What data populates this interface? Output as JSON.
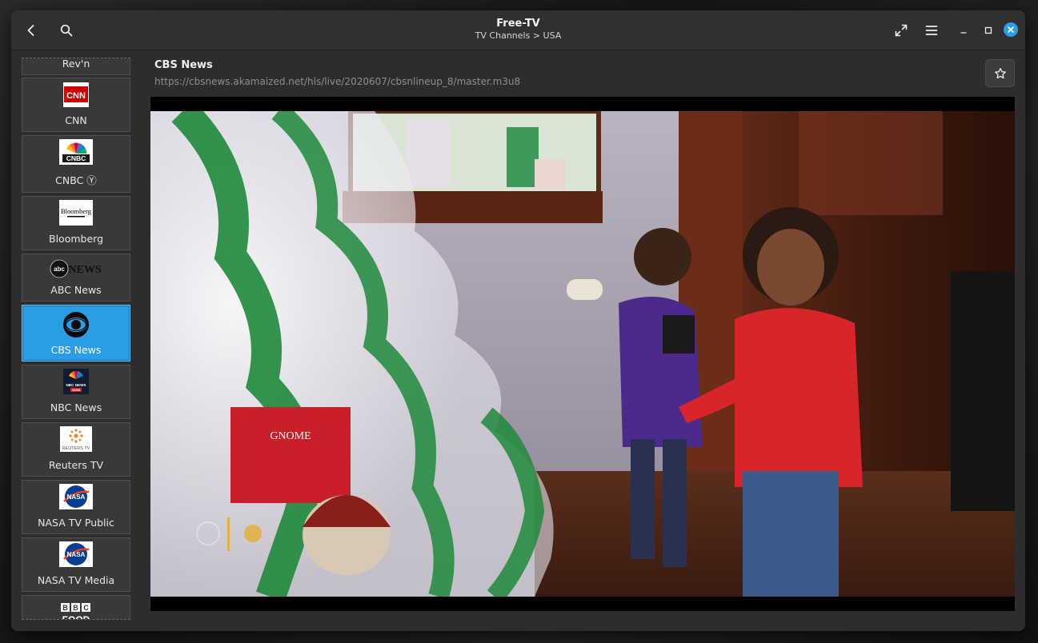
{
  "window": {
    "title": "Free-TV",
    "subtitle": "TV Channels > USA"
  },
  "header": {
    "back_icon": "chevron-left-icon",
    "search_icon": "search-icon",
    "fullscreen_icon": "fullscreen-icon",
    "menu_icon": "hamburger-menu-icon",
    "minimize_icon": "minimize-icon",
    "maximize_icon": "maximize-icon",
    "close_icon": "close-icon"
  },
  "channels": [
    {
      "label": "Rev'n",
      "logo": "revn-logo"
    },
    {
      "label": "CNN",
      "logo": "cnn-logo",
      "logo_text": "CNN"
    },
    {
      "label": "CNBC Ⓨ",
      "logo": "cnbc-logo",
      "logo_text": "CNBC"
    },
    {
      "label": "Bloomberg",
      "logo": "bloomberg-logo",
      "logo_text": "Bloomberg"
    },
    {
      "label": "ABC News",
      "logo": "abc-news-logo",
      "logo_text": "abcNEWS"
    },
    {
      "label": "CBS News",
      "logo": "cbs-eye-logo",
      "active": true
    },
    {
      "label": "NBC News",
      "logo": "nbc-news-logo",
      "logo_text": "NBC NEWS NOW"
    },
    {
      "label": "Reuters TV",
      "logo": "reuters-logo",
      "logo_text": "REUTERS TV"
    },
    {
      "label": "NASA TV Public",
      "logo": "nasa-logo",
      "logo_text": "NASA"
    },
    {
      "label": "NASA TV Media",
      "logo": "nasa-logo",
      "logo_text": "NASA"
    },
    {
      "label": "",
      "logo": "bbc-food-logo",
      "logo_text": "BBC FOOD"
    }
  ],
  "now_playing": {
    "title": "CBS News",
    "url": "https://cbsnews.akamaized.net/hls/live/2020607/cbsnlineup_8/master.m3u8",
    "favorite_icon": "star-icon"
  },
  "colors": {
    "accent": "#2a9de6",
    "window_bg": "#2d2d2d",
    "header_bg": "#303030",
    "close_button": "#2c9ee5"
  }
}
